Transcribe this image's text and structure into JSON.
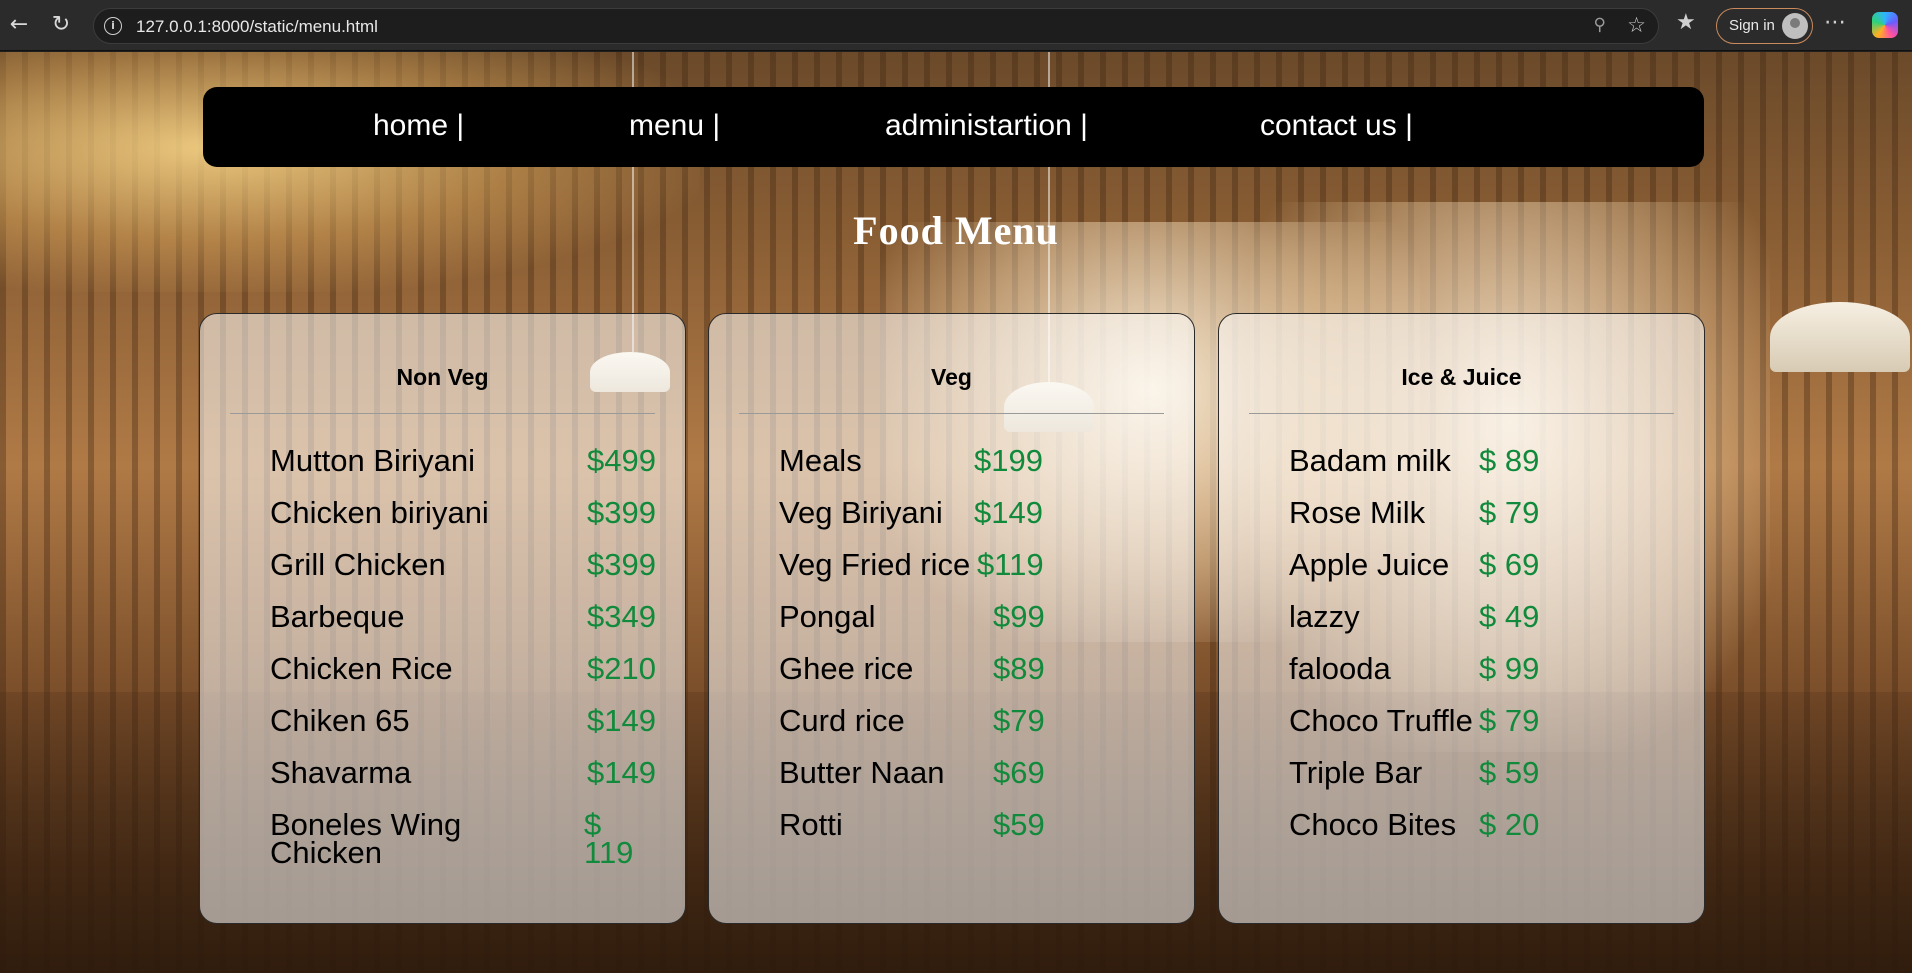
{
  "browser": {
    "url": "127.0.0.1:8000/static/menu.html",
    "sign_in_label": "Sign in",
    "icons": [
      "back-arrow-icon",
      "reload-icon",
      "info-icon",
      "zoom-out-icon",
      "star-icon",
      "favorites-icon",
      "avatar-icon",
      "more-icon",
      "copilot-icon"
    ]
  },
  "nav": {
    "items": [
      "home |",
      "menu |",
      "administartion |",
      "contact us |"
    ]
  },
  "page": {
    "title": "Food Menu"
  },
  "colors": {
    "price": "#118a3c",
    "nav_bg": "#000000",
    "title": "#ffffff"
  },
  "menus": [
    {
      "heading": "Non Veg",
      "items": [
        {
          "name": "Mutton Biriyani",
          "price": "$499"
        },
        {
          "name": "Chicken biriyani",
          "price": "$399"
        },
        {
          "name": "Grill Chicken",
          "price": "$399"
        },
        {
          "name": "Barbeque",
          "price": "$349"
        },
        {
          "name": "Chicken Rice",
          "price": "$210"
        },
        {
          "name": "Chiken 65",
          "price": "$149"
        },
        {
          "name": "Shavarma",
          "price": "$149"
        },
        {
          "name": "Boneles Wing Chicken",
          "price": "$ 119"
        }
      ]
    },
    {
      "heading": "Veg",
      "items": [
        {
          "name": "Meals",
          "price": "$199"
        },
        {
          "name": "Veg Biriyani",
          "price": "$149"
        },
        {
          "name": "Veg Fried rice",
          "price": "$119"
        },
        {
          "name": "Pongal",
          "price": "$99"
        },
        {
          "name": "Ghee rice",
          "price": "$89"
        },
        {
          "name": "Curd rice",
          "price": "$79"
        },
        {
          "name": "Butter Naan",
          "price": "$69"
        },
        {
          "name": "Rotti",
          "price": "$59"
        }
      ]
    },
    {
      "heading": "Ice & Juice",
      "items": [
        {
          "name": "Badam milk",
          "price": "$ 89"
        },
        {
          "name": "Rose Milk",
          "price": "$ 79"
        },
        {
          "name": "Apple Juice",
          "price": "$ 69"
        },
        {
          "name": "lazzy",
          "price": "$ 49"
        },
        {
          "name": "falooda",
          "price": "$ 99"
        },
        {
          "name": "Choco Truffle",
          "price": "$ 79"
        },
        {
          "name": "Triple Bar",
          "price": "$ 59"
        },
        {
          "name": "Choco Bites",
          "price": "$ 20"
        }
      ]
    }
  ]
}
